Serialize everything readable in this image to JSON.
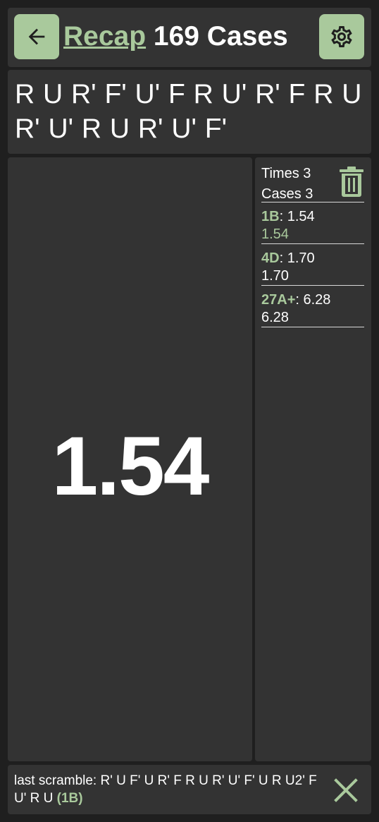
{
  "header": {
    "back_icon": "arrow-left-icon",
    "title_link": "Recap",
    "title_rest": "169 Cases",
    "settings_icon": "gear-icon"
  },
  "scramble": {
    "text": "R U R' F' U' F R U' R' F R U R' U' R U R' U' F'"
  },
  "timer": {
    "value": "1.54"
  },
  "stats": {
    "times_label": "Times",
    "times_count": "3",
    "cases_label": "Cases",
    "cases_count": "3",
    "trash_icon": "trash-icon",
    "entries": [
      {
        "case": "1B",
        "time": "1.54",
        "detail": "1.54"
      },
      {
        "case": "4D",
        "time": "1.70",
        "detail": "1.70"
      },
      {
        "case": "27A+",
        "time": "6.28",
        "detail": "6.28"
      }
    ]
  },
  "footer": {
    "label": "last scramble:",
    "scramble": "R' U F' U R' F R U R' U' F' U R U2' F U' R U",
    "case": "(1B)",
    "close_icon": "close-icon"
  },
  "colors": {
    "background": "#1f1f1f",
    "panel": "#333333",
    "accent": "#a9c99c",
    "text": "#ffffff"
  }
}
